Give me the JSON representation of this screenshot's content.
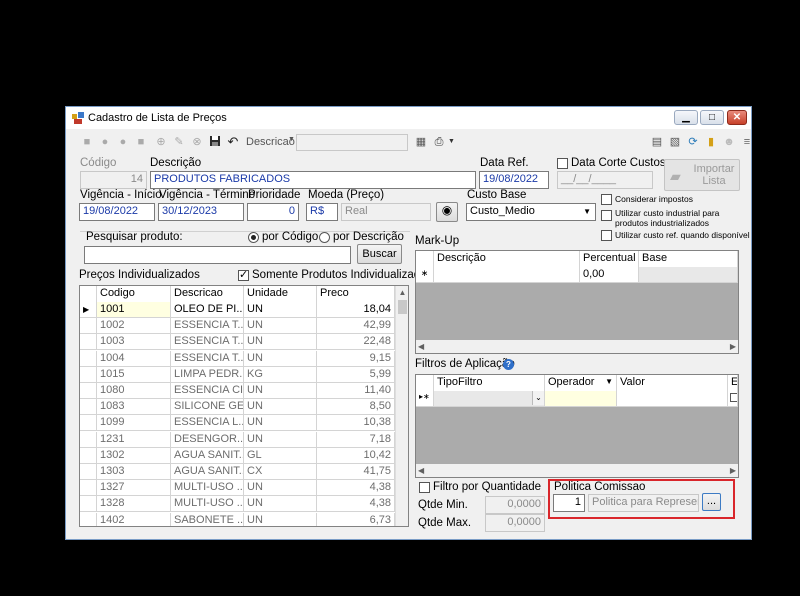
{
  "window": {
    "title": "Cadastro de Lista de Preços"
  },
  "toolbar": {
    "search_label": "Descricao",
    "search_value": ""
  },
  "header": {
    "codigo_label": "Código",
    "codigo_value": "14",
    "descricao_label": "Descrição",
    "descricao_value": "PRODUTOS FABRICADOS",
    "data_ref_label": "Data Ref.",
    "data_ref_value": "19/08/2022",
    "data_corte_label": "Data Corte Custos",
    "data_corte_value": "__/__/____",
    "importar_label": "Importar Lista",
    "vig_inicio_label": "Vigência - Início",
    "vig_inicio_value": "19/08/2022",
    "vig_termino_label": "Vigência - Término",
    "vig_termino_value": "30/12/2023",
    "prioridade_label": "Prioridade",
    "prioridade_value": "0",
    "moeda_label": "Moeda (Preço)",
    "moeda_code": "R$",
    "moeda_name": "Real",
    "custo_base_label": "Custo Base",
    "custo_base_value": "Custo_Medio",
    "considerar_impostos": "Considerar impostos",
    "utilizar_custo_industrial": "Utilizar custo industrial para produtos industrializados",
    "utilizar_custo_ref": "Utilizar custo ref. quando disponível"
  },
  "search": {
    "label": "Pesquisar produto:",
    "value": "",
    "por_codigo": "por Código",
    "por_descricao": "por Descrição",
    "button": "Buscar"
  },
  "precos": {
    "label": "Preços Individualizados",
    "somente_label": "Somente Produtos Individualizados",
    "columns": [
      "Codigo",
      "Descricao",
      "Unidade",
      "Preco"
    ],
    "rows": [
      [
        "1001",
        "OLEO DE PI...",
        "UN",
        "18,04"
      ],
      [
        "1002",
        "ESSENCIA T...",
        "UN",
        "42,99"
      ],
      [
        "1003",
        "ESSENCIA T...",
        "UN",
        "22,48"
      ],
      [
        "1004",
        "ESSENCIA T...",
        "UN",
        "9,15"
      ],
      [
        "1015",
        "LIMPA PEDR...",
        "KG",
        "5,99"
      ],
      [
        "1080",
        "ESSENCIA CI...",
        "UN",
        "11,40"
      ],
      [
        "1083",
        "SILICONE GE...",
        "UN",
        "8,50"
      ],
      [
        "1099",
        "ESSENCIA L...",
        "UN",
        "10,38"
      ],
      [
        "1231",
        "DESENGOR...",
        "UN",
        "7,18"
      ],
      [
        "1302",
        "AGUA SANIT...",
        "GL",
        "10,42"
      ],
      [
        "1303",
        "AGUA SANIT...",
        "CX",
        "41,75"
      ],
      [
        "1327",
        "MULTI-USO ...",
        "UN",
        "4,38"
      ],
      [
        "1328",
        "MULTI-USO ...",
        "UN",
        "4,38"
      ],
      [
        "1402",
        "SABONETE ...",
        "UN",
        "6,73"
      ]
    ]
  },
  "markup": {
    "label": "Mark-Up",
    "columns": [
      "Descrição",
      "Percentual",
      "Base"
    ],
    "new_row_percentual": "0,00"
  },
  "filtros": {
    "label": "Filtros de Aplicação",
    "columns": [
      "TipoFiltro",
      "Operador",
      "Valor",
      "E"
    ]
  },
  "quantidade": {
    "filtro_label": "Filtro por Quantidade",
    "min_label": "Qtde Min.",
    "min_value": "0,0000",
    "max_label": "Qtde Max.",
    "max_value": "0,0000"
  },
  "comissao": {
    "label": "Politica Comissao",
    "id": "1",
    "name": "Politica para Representa",
    "browse_button": "..."
  }
}
